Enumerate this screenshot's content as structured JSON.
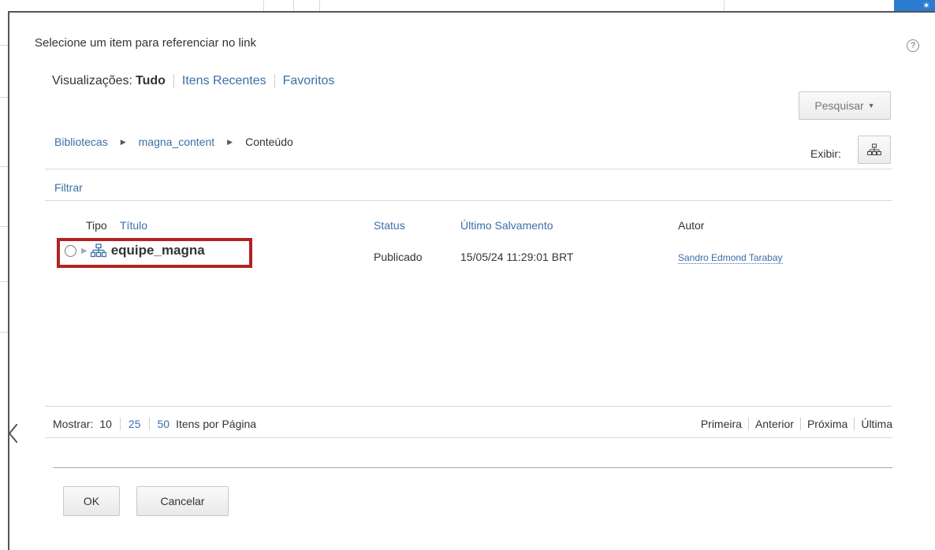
{
  "dialog": {
    "title": "Selecione um item para referenciar no link",
    "help_icon": "question-circle-icon"
  },
  "views": {
    "label": "Visualizações:",
    "active": "Tudo",
    "recent": "Itens Recentes",
    "favorites": "Favoritos"
  },
  "search": {
    "label": "Pesquisar",
    "icon": "caret-down-icon"
  },
  "breadcrumb": {
    "items": [
      "Bibliotecas",
      "magna_content",
      "Conteúdo"
    ]
  },
  "display": {
    "label": "Exibir:",
    "icon": "tree-view-icon"
  },
  "filter": {
    "label": "Filtrar"
  },
  "table": {
    "columns": {
      "type": "Tipo",
      "title": "Título",
      "status": "Status",
      "last_saved": "Último Salvamento",
      "author": "Autor"
    },
    "rows": [
      {
        "title": "equipe_magna",
        "status": "Publicado",
        "last_saved": "15/05/24 11:29:01 BRT",
        "author": "Sandro Edmond Tarabay"
      }
    ]
  },
  "pager": {
    "show_label": "Mostrar:",
    "sizes": [
      "10",
      "25",
      "50"
    ],
    "per_page_label": "Itens por Página",
    "first": "Primeira",
    "previous": "Anterior",
    "next": "Próxima",
    "last": "Última"
  },
  "buttons": {
    "ok": "OK",
    "cancel": "Cancelar"
  },
  "colors": {
    "link": "#3b6fa8",
    "highlight": "#b22222",
    "corner_accent": "#2b7bd0"
  }
}
